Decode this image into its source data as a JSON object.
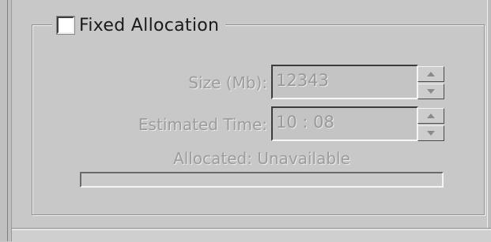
{
  "group": {
    "checkbox_label": "Fixed Allocation",
    "checked": false
  },
  "size": {
    "label": "Size (Mb):",
    "value": "12343"
  },
  "estimated_time": {
    "label": "Estimated Time:",
    "value": "10 : 08"
  },
  "allocated": {
    "label": "Allocated: Unavailable",
    "progress_fraction": 0
  },
  "icons": {
    "spin_up": "triangle-up-icon",
    "spin_down": "triangle-down-icon"
  }
}
